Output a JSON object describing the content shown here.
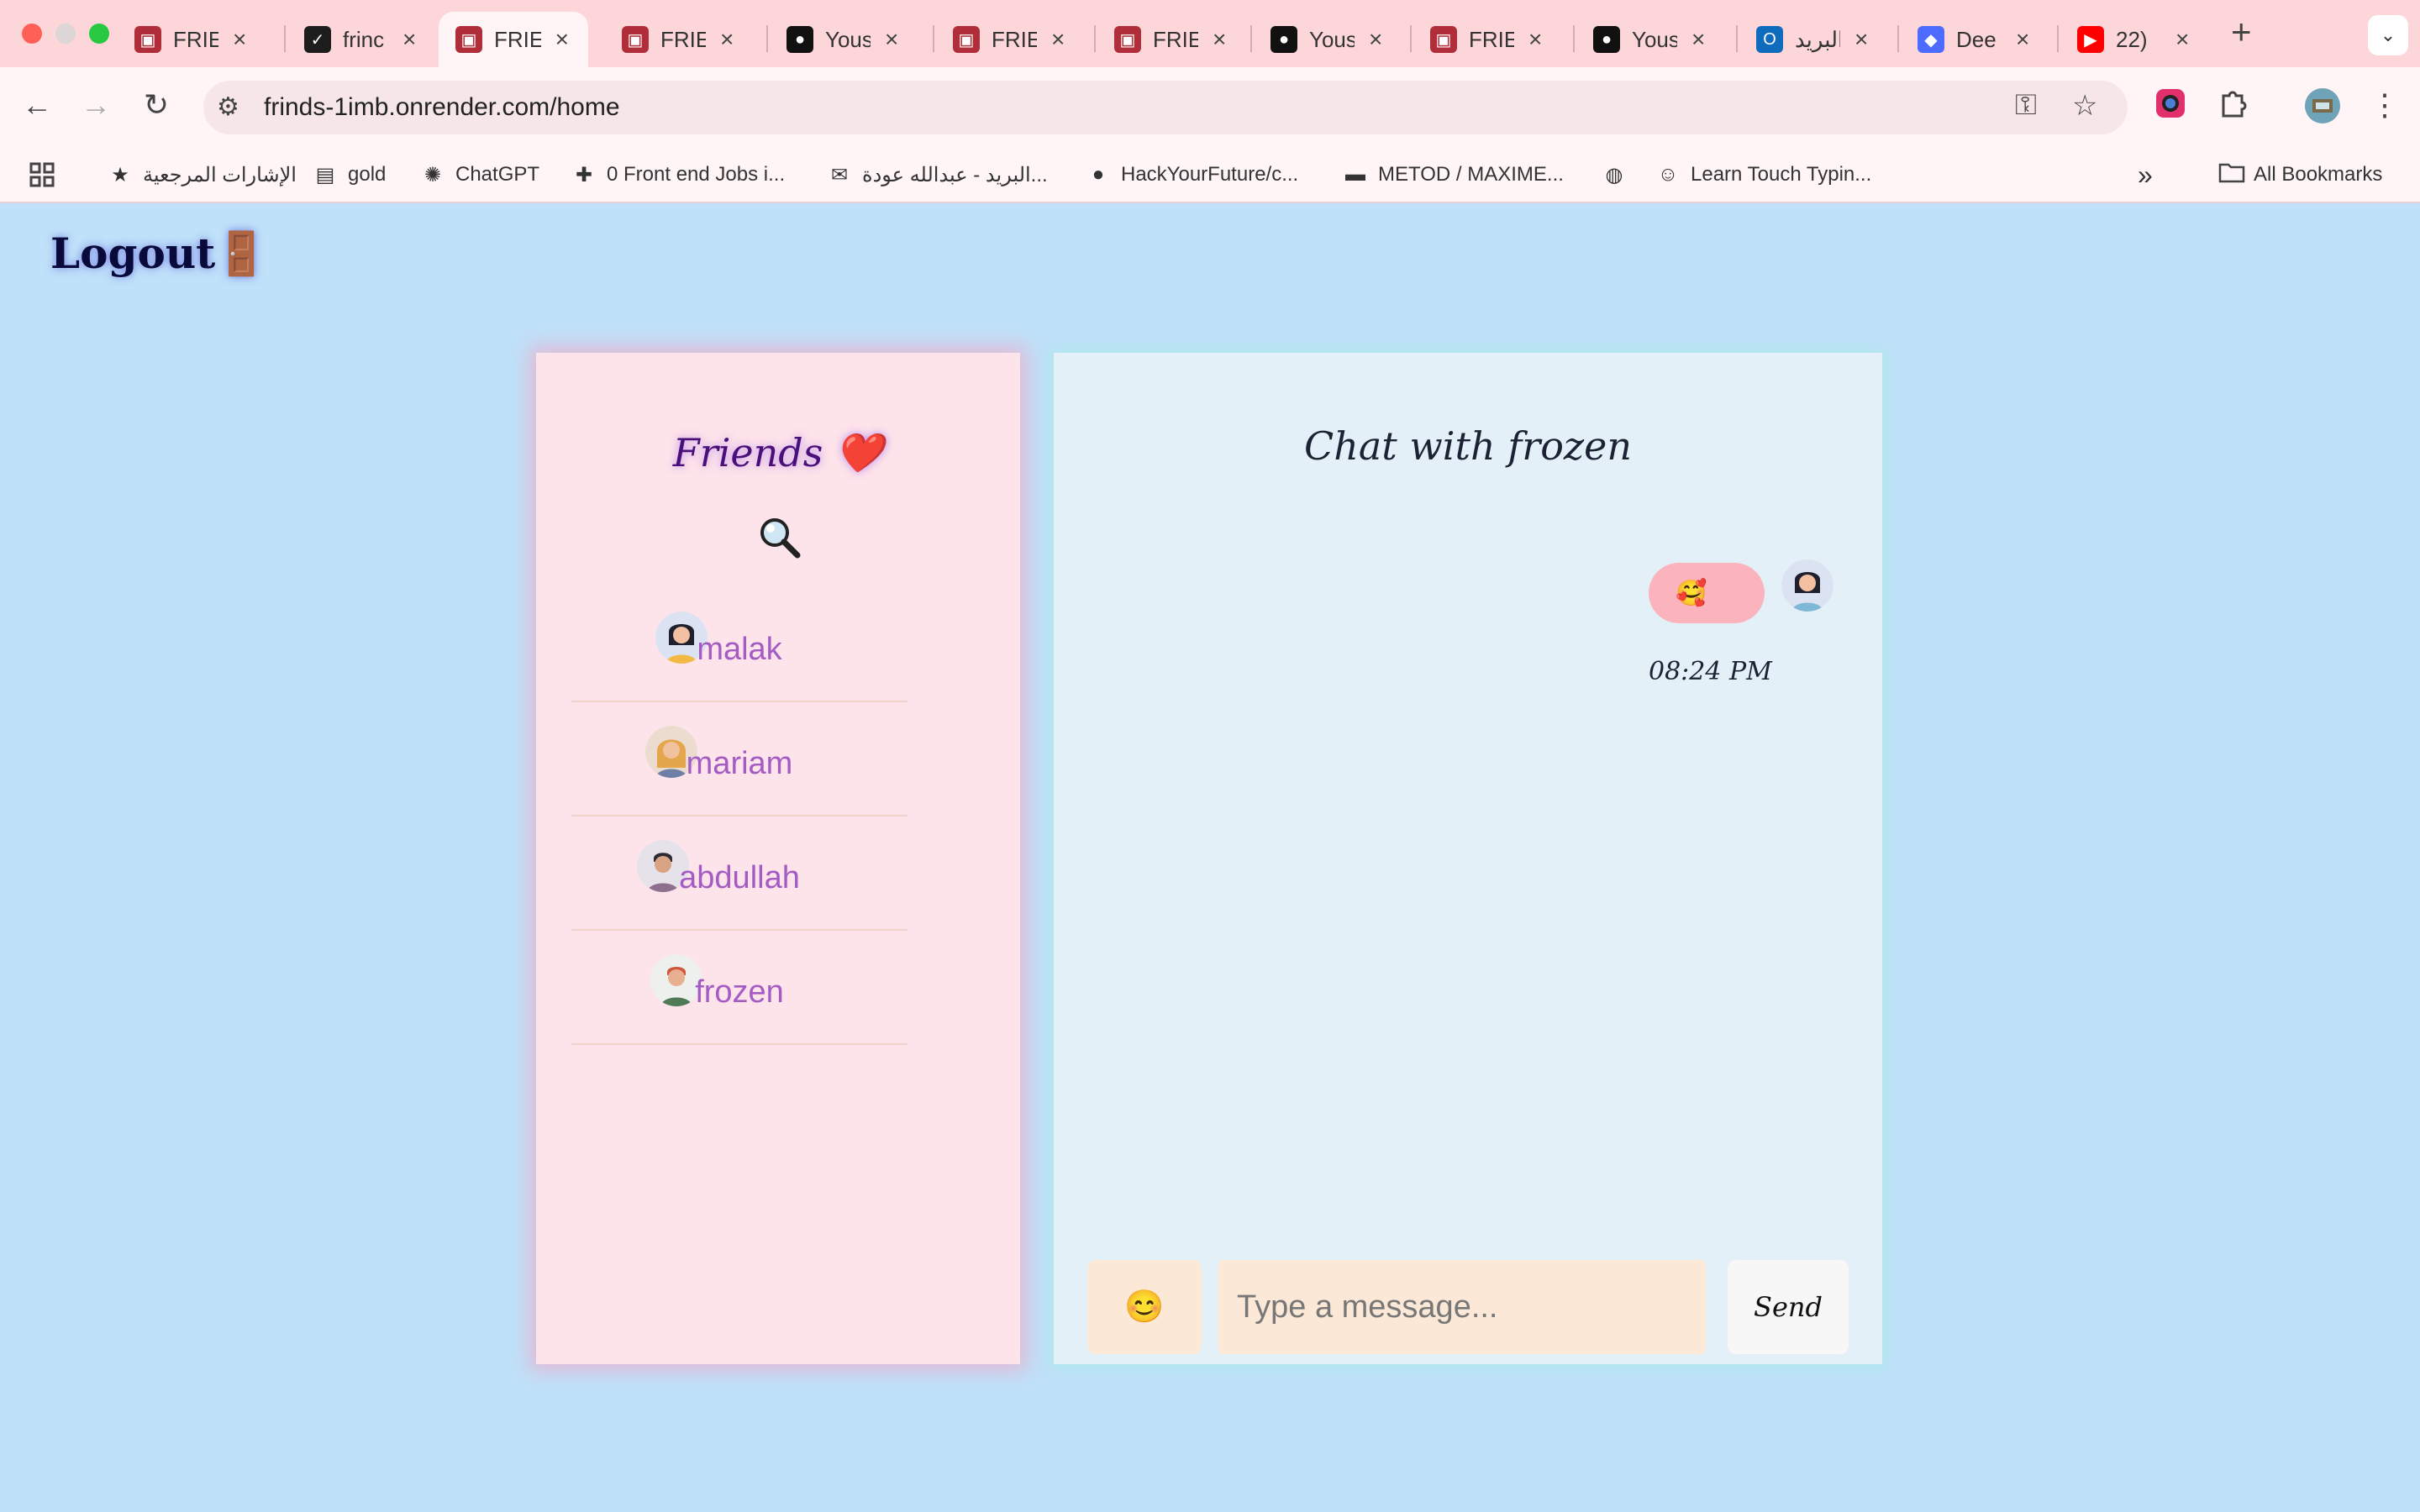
{
  "browser": {
    "tabs": [
      {
        "title": "FRIE",
        "icon": "app-favicon",
        "color": "#b02e3a"
      },
      {
        "title": "frinc",
        "icon": "render-favicon",
        "color": "#1d1d1d"
      },
      {
        "title": "FRIE",
        "icon": "app-favicon",
        "color": "#b02e3a"
      },
      {
        "title": "FRIE",
        "icon": "app-favicon",
        "color": "#b02e3a"
      },
      {
        "title": "Yous",
        "icon": "github-favicon",
        "color": "#111111"
      },
      {
        "title": "FRIE",
        "icon": "app-favicon",
        "color": "#b02e3a"
      },
      {
        "title": "FRIE",
        "icon": "app-favicon",
        "color": "#b02e3a"
      },
      {
        "title": "Yous",
        "icon": "github-favicon",
        "color": "#111111"
      },
      {
        "title": "FRIE",
        "icon": "app-favicon",
        "color": "#b02e3a"
      },
      {
        "title": "Yous",
        "icon": "github-favicon",
        "color": "#111111"
      },
      {
        "title": "البريد",
        "icon": "outlook-favicon",
        "color": "#0f6cbd"
      },
      {
        "title": "Dee",
        "icon": "deepseek-favicon",
        "color": "#4d6bfe"
      },
      {
        "title": "22)",
        "icon": "youtube-favicon",
        "color": "#ff0000"
      }
    ],
    "active_tab": 2,
    "url": "frinds-1imb.onrender.com/home",
    "bookmarks": [
      {
        "label": "الإشارات المرجعية",
        "icon": "star-icon"
      },
      {
        "label": "gold",
        "icon": "inv-icon"
      },
      {
        "label": "ChatGPT",
        "icon": "chatgpt-icon"
      },
      {
        "label": "0 Front end Jobs i...",
        "icon": "jobs-icon"
      },
      {
        "label": "البريد - عبدالله عودة...",
        "icon": "outlook-icon"
      },
      {
        "label": "HackYourFuture/c...",
        "icon": "github-icon"
      },
      {
        "label": "METOD / MAXIME...",
        "icon": "ikea-icon"
      },
      {
        "label": "",
        "icon": "globe-icon"
      },
      {
        "label": "Learn Touch Typin...",
        "icon": "typing-icon"
      }
    ],
    "all_bookmarks": "All Bookmarks"
  },
  "page": {
    "logout_label": "Logout",
    "logout_emoji": "🚪",
    "friends_title": "Friends ❤️",
    "search_icon": "🔍",
    "friends": [
      {
        "name": "malak",
        "avatar": "woman-dark-hair-avatar"
      },
      {
        "name": "mariam",
        "avatar": "woman-blonde-avatar"
      },
      {
        "name": "abdullah",
        "avatar": "man-dark-hair-avatar"
      },
      {
        "name": "frozen",
        "avatar": "man-red-hair-avatar"
      }
    ],
    "chat": {
      "title": "Chat with frozen",
      "messages": [
        {
          "text": "🥰",
          "time": "08:24 PM",
          "avatar": "woman-dark-hair-avatar"
        }
      ],
      "emoji_button": "😊",
      "input_placeholder": "Type a message...",
      "send_label": "Send"
    }
  }
}
